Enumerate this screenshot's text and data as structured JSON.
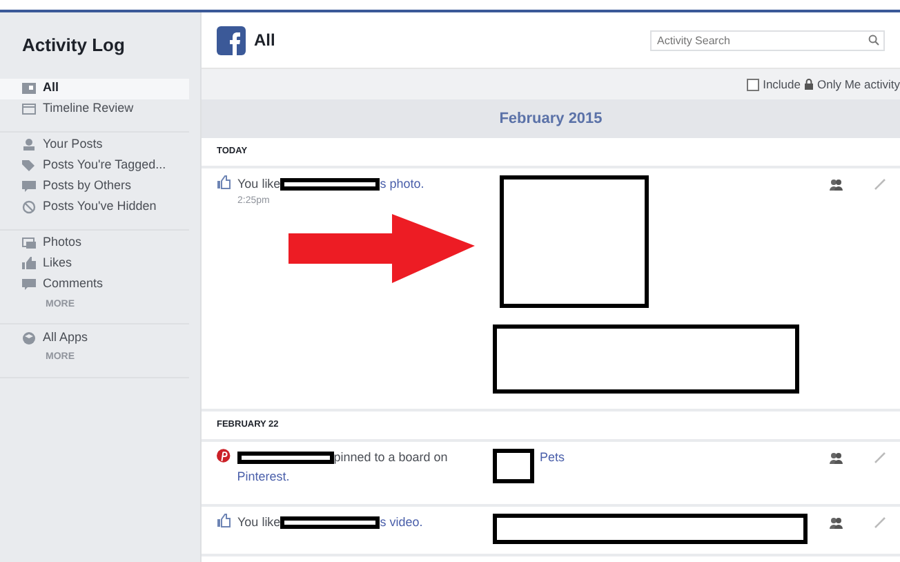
{
  "sidebar": {
    "title": "Activity Log",
    "groups": [
      {
        "items": [
          {
            "label": "All",
            "selected": true
          },
          {
            "label": "Timeline Review",
            "selected": false
          }
        ]
      },
      {
        "items": [
          {
            "label": "Your Posts",
            "selected": false
          },
          {
            "label": "Posts You're Tagged...",
            "selected": false
          },
          {
            "label": "Posts by Others",
            "selected": false
          },
          {
            "label": "Posts You've Hidden",
            "selected": false
          }
        ]
      },
      {
        "items": [
          {
            "label": "Photos",
            "selected": false
          },
          {
            "label": "Likes",
            "selected": false
          },
          {
            "label": "Comments",
            "selected": false
          }
        ],
        "more": "MORE"
      },
      {
        "items": [
          {
            "label": "All Apps",
            "selected": false
          }
        ],
        "more": "MORE"
      }
    ]
  },
  "header": {
    "title": "All",
    "search": {
      "placeholder": "Activity Search"
    }
  },
  "filter": {
    "label": "Include",
    "label_after": "Only Me activity",
    "checked": false
  },
  "month": "February 2015",
  "sections": [
    {
      "heading": "TODAY",
      "entries": [
        {
          "kind": "like",
          "text_before": "You like",
          "link": "s photo.",
          "time": "2:25pm",
          "media": {
            "kind": "photo"
          }
        }
      ]
    },
    {
      "heading": "FEBRUARY 22",
      "entries": [
        {
          "kind": "pin",
          "text_after": "pinned to a board on",
          "link": "Pinterest.",
          "media": {
            "kind": "board",
            "link": "Pets"
          }
        },
        {
          "kind": "like",
          "text_before": "You like",
          "link": "s video.",
          "media": {
            "kind": "wide"
          }
        }
      ]
    }
  ]
}
